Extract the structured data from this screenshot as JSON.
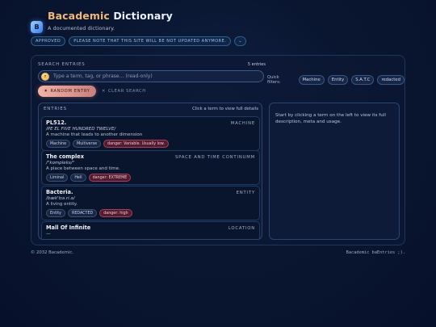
{
  "header": {
    "title_brand": "Bacademic",
    "title_rest": "Dictionary",
    "logo_glyph": "B",
    "subtitle": "A documented dictionary.",
    "badges": [
      "APPROVED",
      "PLEASE NOTE THAT THIS SITE WILL BE NOT UPDATED ANYMORE.",
      "⌄"
    ]
  },
  "search": {
    "label": "SEARCH ENTRIES",
    "count": "5 entries",
    "placeholder": "Type a term, tag, or phrase… (read-only)",
    "quick_label": "Quick filters:",
    "quick_filters": [
      "Machine",
      "Entity",
      "S.A.T.C",
      "redacted"
    ],
    "random_label": "RANDOM ENTRY",
    "clear_label": "CLEAR SEARCH"
  },
  "entries_panel": {
    "label": "ENTRIES",
    "hint": "Click a term to view full details",
    "items": [
      {
        "title": "PL512.",
        "type": "MACHINE",
        "pron": "/PE EL FIVE HUNDRED TWELVE/",
        "desc": "A machine that leads to another dimension",
        "tags": [
          "Machine",
          "Multiverse"
        ],
        "danger": "danger: Variable. Usually low."
      },
      {
        "title": "The complex",
        "type": "SPACE AND TIME CONTINUMM",
        "pron": "/\"kompleks/\"",
        "desc": "A place between space and time.",
        "tags": [
          "Liminal",
          "Hell"
        ],
        "danger": "danger: EXTREME"
      },
      {
        "title": "Bacteria.",
        "type": "ENTITY",
        "pron": "/bæk'tɪə.ri.ə/",
        "desc": "A living entity.",
        "tags": [
          "Entity",
          "REDACTED"
        ],
        "danger": "danger: high"
      },
      {
        "title": "Mall Of Infinite",
        "type": "LOCATION",
        "pron": "—"
      }
    ]
  },
  "details": {
    "text": "Start by clicking a term on the left to view its full description, meta and usage."
  },
  "footer": {
    "left": "© 2032 Bacademic.",
    "right": "Bacademic baEntries ;)."
  },
  "colors": {
    "brand": "#f0b977",
    "accent": "#3b7cf0",
    "danger": "#a2425a"
  },
  "icons": {
    "logo": "book-icon",
    "search": "search-icon",
    "random": "star-icon",
    "clear": "close-icon"
  }
}
